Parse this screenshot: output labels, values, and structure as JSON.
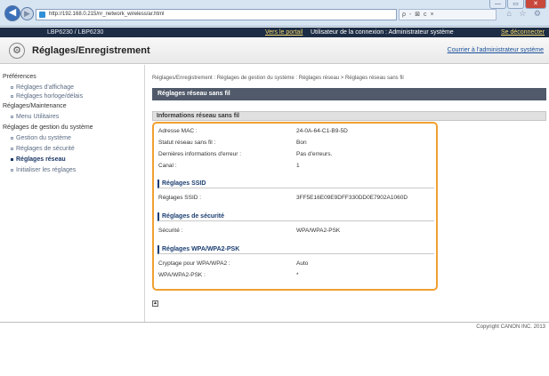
{
  "browser": {
    "url": "http://192.168.0.215/nr_network_wireless/ar.html",
    "search": "ρ - ⊠ c ×",
    "toolbar_icons": "⌂ ☆ ⚙",
    "window_controls": [
      "—",
      "▭",
      "✕"
    ]
  },
  "app_bar": {
    "model": "LBP6230 / LBP6230",
    "portal_link": "Vers le portail",
    "user_info": "Utilisateur de la connexion : Administrateur système",
    "logout_link": "Se déconnecter"
  },
  "title_bar": {
    "title": "Réglages/Enregistrement",
    "admin_link": "Courrier à l'administrateur système"
  },
  "sidebar": {
    "items": [
      {
        "label": "Préférences",
        "kind": "category"
      },
      {
        "label": "Réglages d'affichage",
        "kind": "sub"
      },
      {
        "label": "Réglages horloge/délais",
        "kind": "sub"
      },
      {
        "label": "Réglages/Maintenance",
        "kind": "category"
      },
      {
        "label": "Menu Utilitaires",
        "kind": "sub"
      },
      {
        "label": "Réglages de gestion du système",
        "kind": "category"
      },
      {
        "label": "Gestion du système",
        "kind": "sub"
      },
      {
        "label": "Réglages de sécurité",
        "kind": "sub"
      },
      {
        "label": "Réglages réseau",
        "kind": "sub",
        "active": true
      },
      {
        "label": "Initialiser les réglages",
        "kind": "sub"
      }
    ]
  },
  "main": {
    "breadcrumb": "Réglages/Enregistrement : Réglages de gestion du système : Réglages réseau > Réglages réseau sans fil",
    "page_heading": "Réglages réseau sans fil",
    "section_heading": "Informations réseau sans fil",
    "info_rows": [
      {
        "label": "Adresse MAC :",
        "value": "24-0A-64-C1-B9-5D"
      },
      {
        "label": "Statut réseau sans fil :",
        "value": "Bon"
      },
      {
        "label": "Dernières informations d'erreur :",
        "value": "Pas d'erreurs."
      },
      {
        "label": "Canal :",
        "value": "1"
      }
    ],
    "ssid": {
      "heading": "Réglages SSID",
      "label": "Réglages SSID :",
      "value": "3FF5E16E09E9DFF330DD0E7902A1060D"
    },
    "security": {
      "heading": "Réglages de sécurité",
      "label": "Sécurité :",
      "value": "WPA/WPA2-PSK"
    },
    "wpa": {
      "heading": "Réglages WPA/WPA2-PSK",
      "rows": [
        {
          "label": "Cryptage pour WPA/WPA2 :",
          "value": "Auto"
        },
        {
          "label": "WPA/WPA2-PSK :",
          "value": "*"
        }
      ]
    }
  },
  "footer": {
    "copyright": "Copyright CANON INC. 2013"
  }
}
